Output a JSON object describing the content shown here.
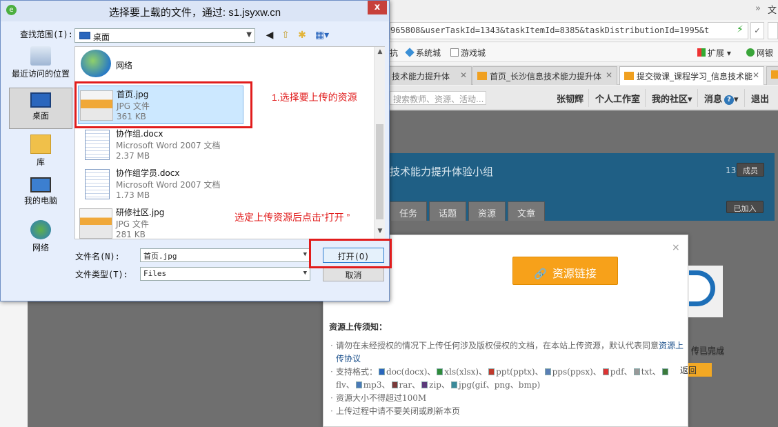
{
  "dialog": {
    "title": "选择要上载的文件，通过: s1.jsyxw.cn",
    "close_symbol": "x",
    "lookin_label": "查找范围(I):",
    "lookin_value": "桌面",
    "places": [
      {
        "label": "最近访问的位置"
      },
      {
        "label": "桌面"
      },
      {
        "label": "库"
      },
      {
        "label": "我的电脑"
      },
      {
        "label": "网络"
      }
    ],
    "network_item": "网络",
    "files": [
      {
        "name": "首页.jpg",
        "type": "JPG 文件",
        "size": "361 KB"
      },
      {
        "name": "协作组.docx",
        "type": "Microsoft Word 2007 文档",
        "size": "2.37 MB"
      },
      {
        "name": "协作组学员.docx",
        "type": "Microsoft Word 2007 文档",
        "size": "1.73 MB"
      },
      {
        "name": "研修社区.jpg",
        "type": "JPG 文件",
        "size": "281 KB"
      }
    ],
    "filename_label": "文件名(N):",
    "filename_value": "首页.jpg",
    "filetype_label": "文件类型(T):",
    "filetype_value": "Files",
    "open_button": "打开(O)",
    "cancel_button": "取消"
  },
  "annotations": {
    "step1": "1.选择要上传的资源",
    "step2": "选定上传资源后点击”打开 ”"
  },
  "browser": {
    "title_cut": "文",
    "address": "965808&userTaskId=1343&taskItemId=8385&taskDistributionId=1995&t",
    "bookmarks": {
      "item0": "抗",
      "item1": "系统城",
      "item2": "游戏城",
      "extensions": "扩展",
      "netbank": "网银"
    },
    "tabs": [
      {
        "label": "技术能力提升体"
      },
      {
        "label": "首页_长沙信息技术能力提升体"
      },
      {
        "label": "提交微课_课程学习_信息技术能"
      }
    ],
    "site_nav": {
      "search_placeholder": "搜索教师、资源、活动...",
      "user": "张韧辉",
      "workspace": "个人工作室",
      "community": "我的社区",
      "messages": "消息",
      "logout": "退出"
    },
    "group_name": "技术能力提升体验小组",
    "member_count": "13",
    "member_button": "成员",
    "group_tabs": [
      "任务",
      "话题",
      "资源",
      "文章"
    ],
    "joined_button": "已加入"
  },
  "modal": {
    "close_symbol": "×",
    "resource_link_button": "资源链接",
    "upload_done": "传已完成",
    "return_button": "返回",
    "notice_title": "资源上传须知：",
    "notice_1": "请勿在未经授权的情况下上传任何涉及版权侵权的文档，在本站上传资源，默认代表同意",
    "notice_1_link": "资源上传协议",
    "notice_2": "支持格式：",
    "formats": [
      "doc(docx)、",
      "xls(xlsx)、",
      "ppt(pptx)、",
      "pps(ppsx)、",
      "pdf、",
      "txt、",
      "flv、",
      "mp3、",
      "rar、",
      "zip、",
      "jpg(gif、png、bmp)"
    ],
    "notice_3": "资源大小不得超过100M",
    "notice_4": "上传过程中请不要关闭或刷新本页"
  },
  "colors": {
    "annotation_red": "#e11c1c",
    "accent_orange": "#f7a11a",
    "dialog_bg": "#e6eefc",
    "selection_blue": "#cce8ff"
  }
}
